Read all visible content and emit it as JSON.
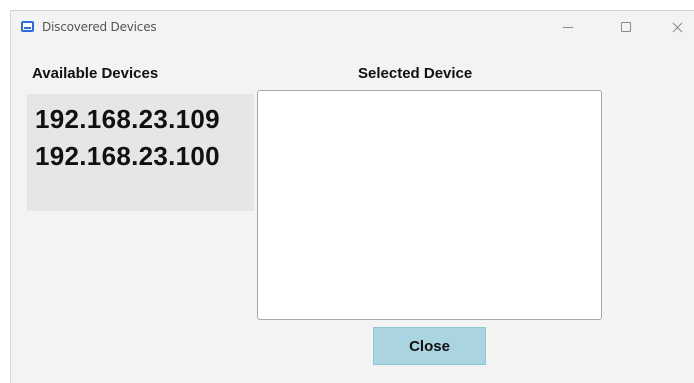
{
  "window": {
    "title": "Discovered Devices",
    "icon": "app-window-icon",
    "controls": {
      "minimize_icon": "minimize-icon",
      "maximize_icon": "maximize-icon",
      "close_icon": "close-icon"
    }
  },
  "available": {
    "label": "Available Devices",
    "devices": [
      "192.168.23.109",
      "192.168.23.100"
    ]
  },
  "selected": {
    "label": "Selected Device",
    "value": ""
  },
  "actions": {
    "close_label": "Close"
  },
  "colors": {
    "accent": "#2b6cd8",
    "close_button_bg": "#a9d4e0",
    "list_bg": "#e6e6e6"
  }
}
